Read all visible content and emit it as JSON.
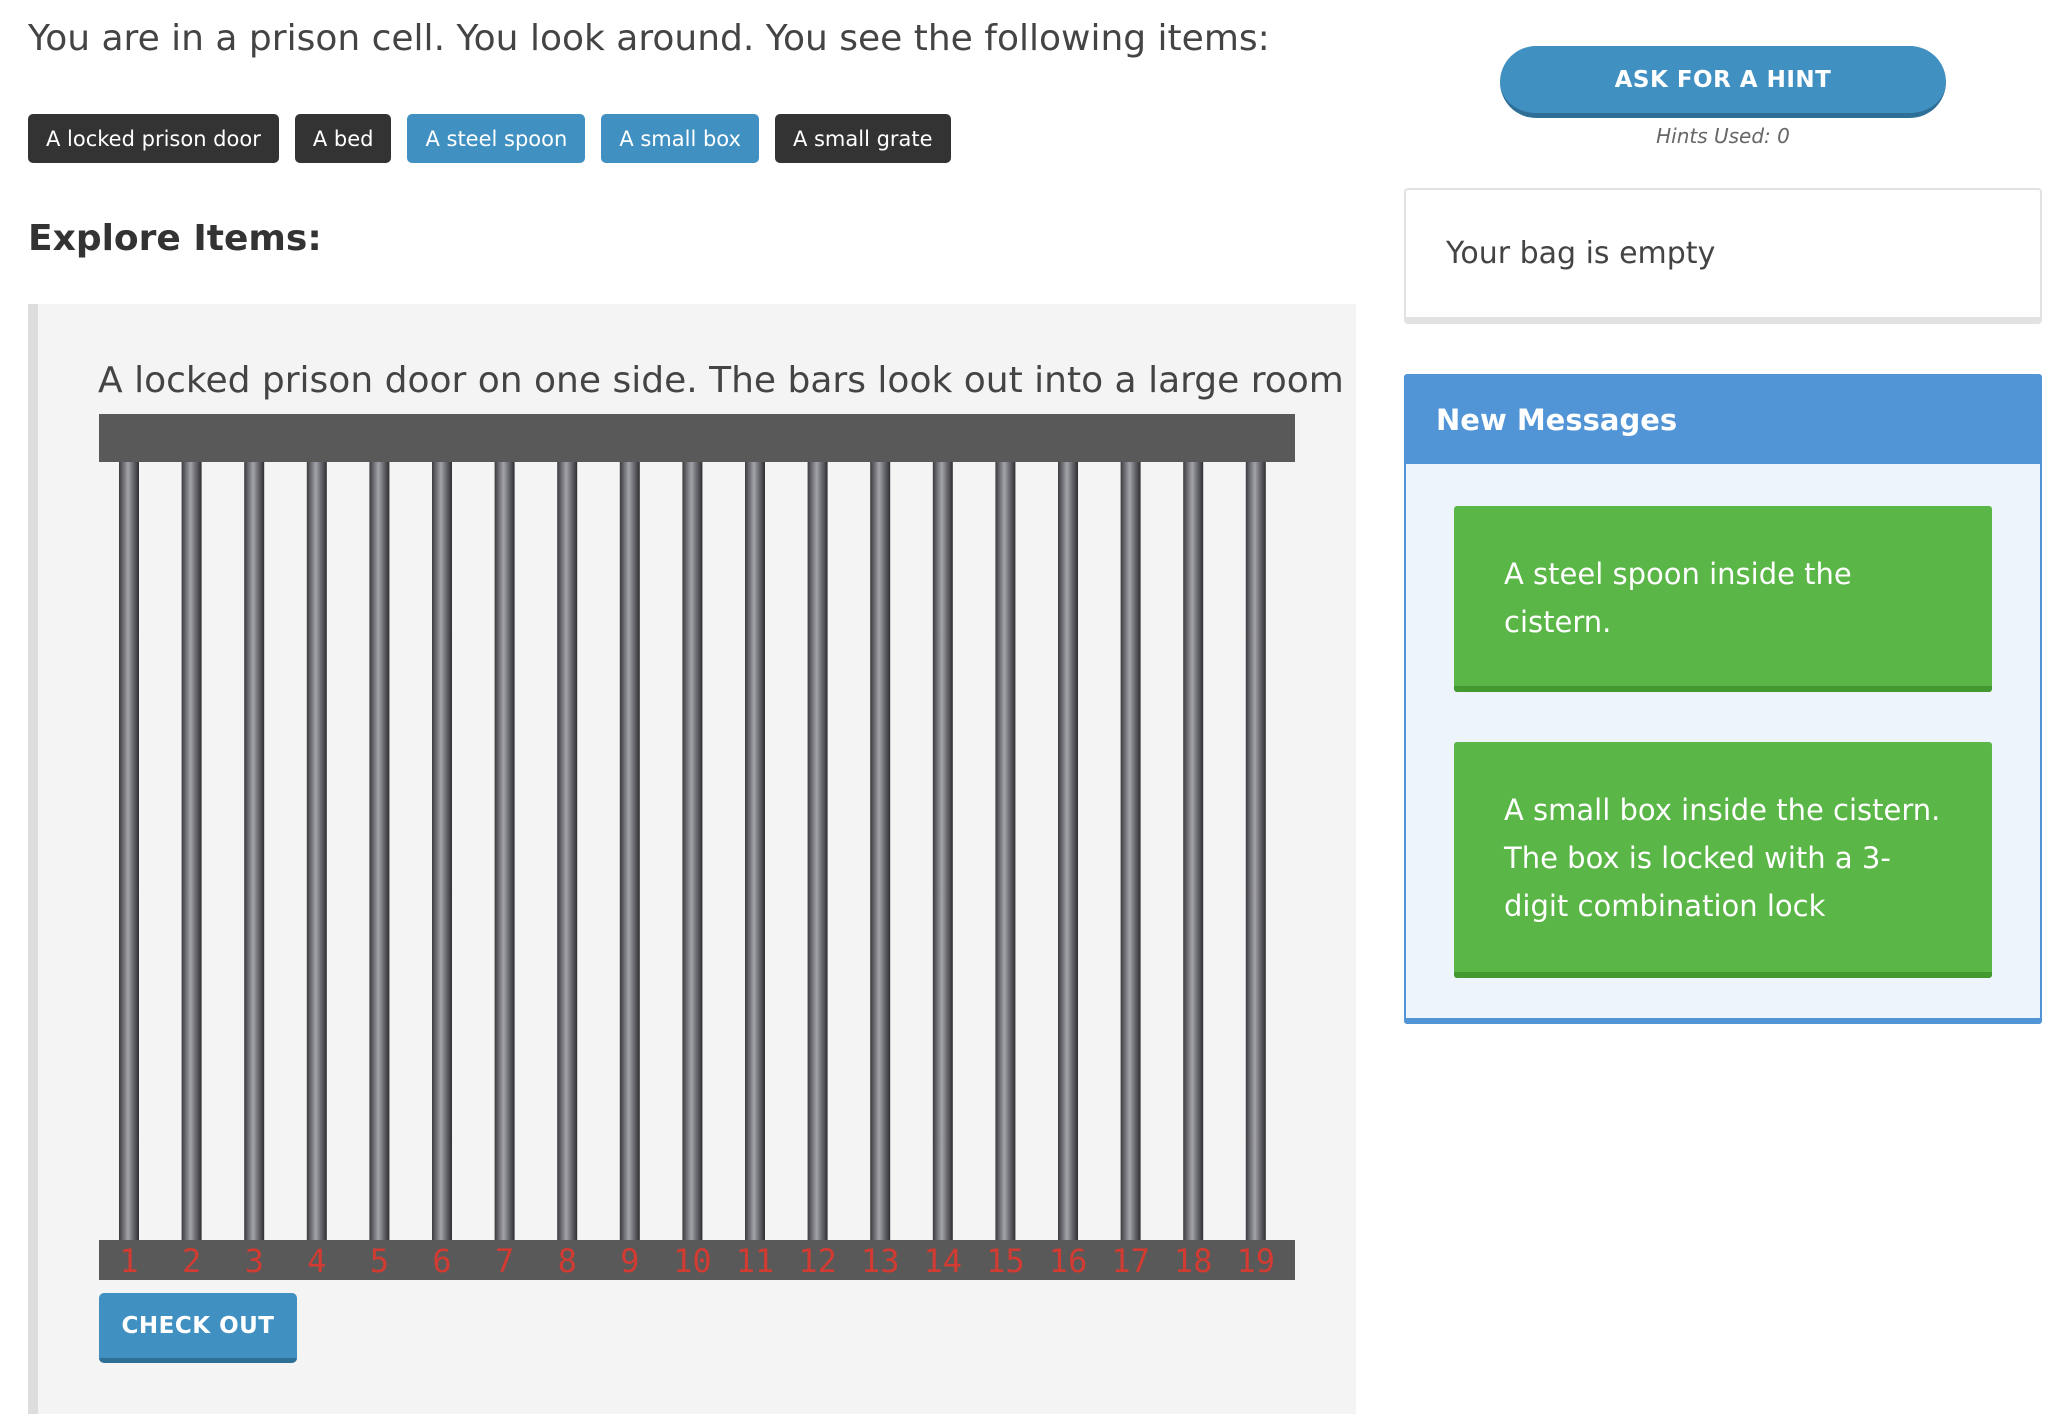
{
  "intro": "You are in a prison cell. You look around. You see the following items:",
  "items": [
    {
      "label": "A locked prison door",
      "style": "dark"
    },
    {
      "label": "A bed",
      "style": "dark"
    },
    {
      "label": "A steel spoon",
      "style": "blue"
    },
    {
      "label": "A small box",
      "style": "blue"
    },
    {
      "label": "A small grate",
      "style": "dark"
    }
  ],
  "explore_title": "Explore Items:",
  "scene": {
    "description": "A locked prison door on one side. The bars look out into a large room",
    "bar_numbers": [
      "1",
      "2",
      "3",
      "4",
      "5",
      "6",
      "7",
      "8",
      "9",
      "10",
      "11",
      "12",
      "13",
      "14",
      "15",
      "16",
      "17",
      "18",
      "19"
    ],
    "checkout_label": "CHECK OUT"
  },
  "hint": {
    "button_label": "ASK FOR A HINT",
    "hints_used": "Hints Used: 0"
  },
  "bag": {
    "text": "Your bag is empty"
  },
  "messages": {
    "header": "New Messages",
    "items": [
      "A steel spoon inside the cistern.",
      "A small box inside the cistern. The box is locked with a 3-digit combination lock"
    ]
  },
  "colors": {
    "dark_button": "#333333",
    "blue_button": "#4091c2",
    "message_green": "#5ab646",
    "messages_header": "#5195d6",
    "bar_number": "#d23b32",
    "frame": "#595959"
  }
}
